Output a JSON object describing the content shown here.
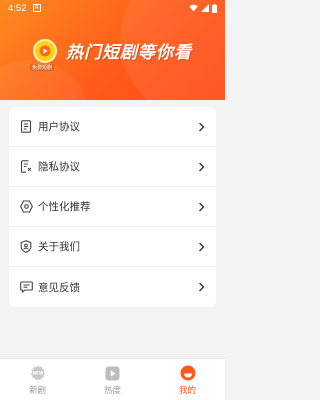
{
  "status_bar": {
    "time": "4:52",
    "notification_glyph": "A"
  },
  "header": {
    "logo_caption": "免费短剧",
    "slogan": "热门短剧等你看",
    "accent_color": "#ff5b1a"
  },
  "menu": {
    "items": [
      {
        "label": "用户协议",
        "icon": "document-icon"
      },
      {
        "label": "隐私协议",
        "icon": "privacy-document-icon"
      },
      {
        "label": "个性化推荐",
        "icon": "settings-hexagon-icon"
      },
      {
        "label": "关于我们",
        "icon": "shield-user-icon"
      },
      {
        "label": "意见反馈",
        "icon": "feedback-message-icon"
      }
    ]
  },
  "tabbar": {
    "tabs": [
      {
        "label": "新剧",
        "badge": "NEW",
        "active": false
      },
      {
        "label": "热度",
        "active": false
      },
      {
        "label": "我的",
        "active": true
      }
    ]
  }
}
